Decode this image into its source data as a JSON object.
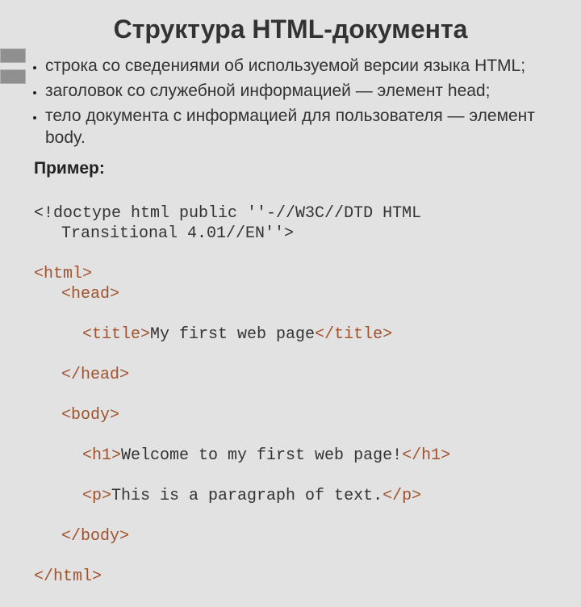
{
  "title": "Структура HTML-документа",
  "bullets": [
    "строка со сведениями об используемой версии языка HTML;",
    "заголовок  со служебной информацией — элемент head;",
    "тело документа с информацией для пользователя — элемент body."
  ],
  "example_label": "Пример:",
  "code": {
    "line1": "<!doctype html public ''-//W3C//DTD HTML",
    "line1b": "Transitional 4.01//EN''>",
    "line2": "<html>",
    "line3": "<head>",
    "line4a": "<title>",
    "line4b": "My first web page",
    "line4c": "</title>",
    "line5": "</head>",
    "line6": "<body>",
    "line7a": "<h1>",
    "line7b": "Welcome to my first web page!",
    "line7c": "</h1>",
    "line8a": "<p>",
    "line8b": "This is a paragraph of text.",
    "line8c": "</p>",
    "line9": "</body>",
    "line10": "</html>"
  }
}
